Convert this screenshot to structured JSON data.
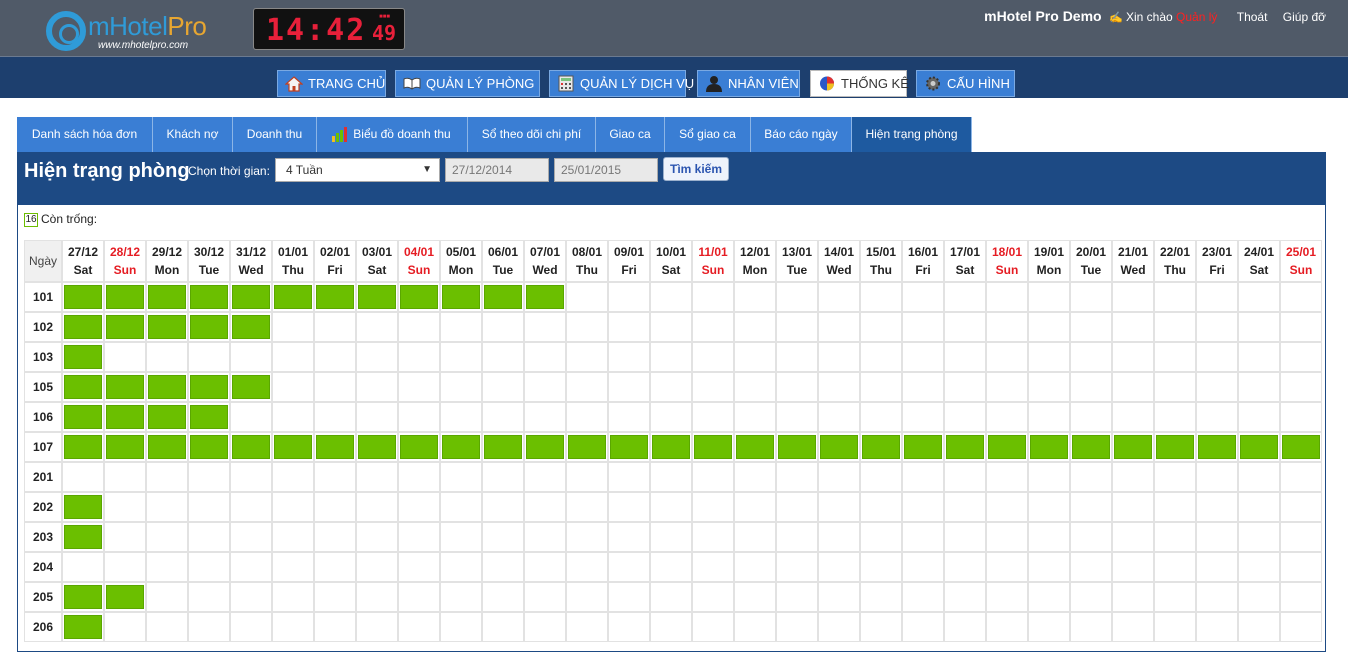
{
  "header": {
    "logo_text_main": "mHotel",
    "logo_text_accent": "Pro",
    "logo_url": "www.mhotelpro.com",
    "clock": "14:42",
    "clock_seconds": "49",
    "brand": "mHotel Pro Demo",
    "greeting": "Xin chào",
    "username": "Quản lý",
    "logout": "Thoát",
    "help": "Giúp đỡ"
  },
  "nav": [
    {
      "label": "TRANG CHỦ",
      "icon": "home-icon"
    },
    {
      "label": "QUẢN LÝ PHÒNG",
      "icon": "book-icon"
    },
    {
      "label": "QUẢN LÝ DỊCH VỤ",
      "icon": "calculator-icon"
    },
    {
      "label": "NHÂN VIÊN",
      "icon": "user-icon"
    },
    {
      "label": "THỐNG KÊ",
      "icon": "pie-chart-icon",
      "active": true
    },
    {
      "label": "CẤU HÌNH",
      "icon": "gear-icon"
    }
  ],
  "subtabs": [
    {
      "label": "Danh sách hóa đơn"
    },
    {
      "label": "Khách nợ"
    },
    {
      "label": "Doanh thu"
    },
    {
      "label": "Biểu đồ doanh thu",
      "icon": "bar-chart-icon"
    },
    {
      "label": "Sổ theo dõi chi phí"
    },
    {
      "label": "Giao ca"
    },
    {
      "label": "Sổ giao ca"
    },
    {
      "label": "Báo cáo ngày"
    },
    {
      "label": "Hiện trạng phòng",
      "active": true
    }
  ],
  "panel": {
    "title": "Hiện trạng phòng",
    "filter_label": "Chọn thời gian:",
    "period": "4 Tuần",
    "date_from": "27/12/2014",
    "date_to": "25/01/2015",
    "search_button": "Tìm kiếm",
    "legend_count": "16",
    "legend_label": "Còn trống:"
  },
  "grid": {
    "corner_label": "Ngày",
    "days": [
      {
        "date": "27/12",
        "dow": "Sat",
        "sun": false
      },
      {
        "date": "28/12",
        "dow": "Sun",
        "sun": true
      },
      {
        "date": "29/12",
        "dow": "Mon",
        "sun": false
      },
      {
        "date": "30/12",
        "dow": "Tue",
        "sun": false
      },
      {
        "date": "31/12",
        "dow": "Wed",
        "sun": false
      },
      {
        "date": "01/01",
        "dow": "Thu",
        "sun": false
      },
      {
        "date": "02/01",
        "dow": "Fri",
        "sun": false
      },
      {
        "date": "03/01",
        "dow": "Sat",
        "sun": false
      },
      {
        "date": "04/01",
        "dow": "Sun",
        "sun": true
      },
      {
        "date": "05/01",
        "dow": "Mon",
        "sun": false
      },
      {
        "date": "06/01",
        "dow": "Tue",
        "sun": false
      },
      {
        "date": "07/01",
        "dow": "Wed",
        "sun": false
      },
      {
        "date": "08/01",
        "dow": "Thu",
        "sun": false
      },
      {
        "date": "09/01",
        "dow": "Fri",
        "sun": false
      },
      {
        "date": "10/01",
        "dow": "Sat",
        "sun": false
      },
      {
        "date": "11/01",
        "dow": "Sun",
        "sun": true
      },
      {
        "date": "12/01",
        "dow": "Mon",
        "sun": false
      },
      {
        "date": "13/01",
        "dow": "Tue",
        "sun": false
      },
      {
        "date": "14/01",
        "dow": "Wed",
        "sun": false
      },
      {
        "date": "15/01",
        "dow": "Thu",
        "sun": false
      },
      {
        "date": "16/01",
        "dow": "Fri",
        "sun": false
      },
      {
        "date": "17/01",
        "dow": "Sat",
        "sun": false
      },
      {
        "date": "18/01",
        "dow": "Sun",
        "sun": true
      },
      {
        "date": "19/01",
        "dow": "Mon",
        "sun": false
      },
      {
        "date": "20/01",
        "dow": "Tue",
        "sun": false
      },
      {
        "date": "21/01",
        "dow": "Wed",
        "sun": false
      },
      {
        "date": "22/01",
        "dow": "Thu",
        "sun": false
      },
      {
        "date": "23/01",
        "dow": "Fri",
        "sun": false
      },
      {
        "date": "24/01",
        "dow": "Sat",
        "sun": false
      },
      {
        "date": "25/01",
        "dow": "Sun",
        "sun": true
      }
    ],
    "rooms": [
      {
        "room": "101",
        "occupied_days": 12
      },
      {
        "room": "102",
        "occupied_days": 5
      },
      {
        "room": "103",
        "occupied_days": 1
      },
      {
        "room": "105",
        "occupied_days": 5
      },
      {
        "room": "106",
        "occupied_days": 4
      },
      {
        "room": "107",
        "occupied_days": 30
      },
      {
        "room": "201",
        "occupied_days": 0
      },
      {
        "room": "202",
        "occupied_days": 1
      },
      {
        "room": "203",
        "occupied_days": 1
      },
      {
        "room": "204",
        "occupied_days": 0
      },
      {
        "room": "205",
        "occupied_days": 2
      },
      {
        "room": "206",
        "occupied_days": 1
      }
    ]
  },
  "colors": {
    "occupied": "#6bbf00",
    "sunday": "#e51c23",
    "nav_bg": "#1d3f6e",
    "button_bg": "#3a7ed4"
  }
}
